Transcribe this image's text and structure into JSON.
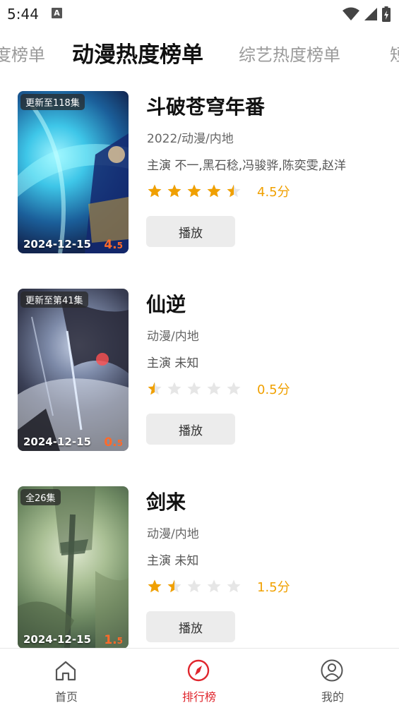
{
  "status_bar": {
    "time": "5:44",
    "notification_badge": "A"
  },
  "tabs": [
    {
      "label": "度榜单",
      "active": false
    },
    {
      "label": "动漫热度榜单",
      "active": true
    },
    {
      "label": "综艺热度榜单",
      "active": false
    },
    {
      "label": "短",
      "active": false
    }
  ],
  "items": [
    {
      "title": "斗破苍穹年番",
      "badge": "更新至118集",
      "date": "2024-12-15",
      "poster_score_main": "4.",
      "poster_score_sub": "5",
      "meta": "2022/动漫/内地",
      "cast": "主演 不一,黑石稔,冯骏骅,陈奕雯,赵洋",
      "rating": 4.5,
      "score_text": "4.5分",
      "play_label": "播放"
    },
    {
      "title": "仙逆",
      "badge": "更新至第41集",
      "date": "2024-12-15",
      "poster_score_main": "0.",
      "poster_score_sub": "5",
      "meta": "动漫/内地",
      "cast": "主演 未知",
      "rating": 0.5,
      "score_text": "0.5分",
      "play_label": "播放"
    },
    {
      "title": "剑来",
      "badge": "全26集",
      "date": "2024-12-15",
      "poster_score_main": "1.",
      "poster_score_sub": "5",
      "meta": "动漫/内地",
      "cast": "主演 未知",
      "rating": 1.5,
      "score_text": "1.5分",
      "play_label": "播放"
    }
  ],
  "bottom_nav": [
    {
      "label": "首页",
      "icon": "home-icon",
      "active": false
    },
    {
      "label": "排行榜",
      "icon": "compass-icon",
      "active": true
    },
    {
      "label": "我的",
      "icon": "user-icon",
      "active": false
    }
  ],
  "colors": {
    "accent": "#e0262d",
    "star": "#f0a000",
    "star_empty": "#e6e6e6",
    "poster_score": "#ff6a2a"
  }
}
